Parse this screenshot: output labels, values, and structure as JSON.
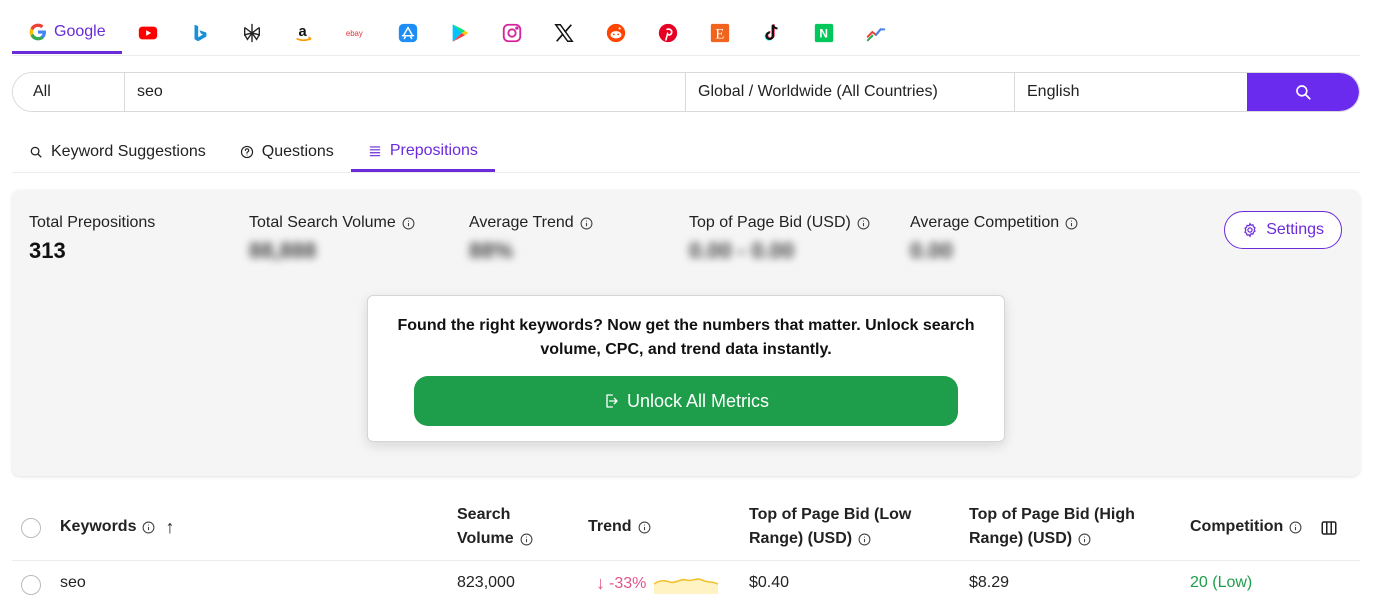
{
  "engines": {
    "google_label": "Google",
    "icons": [
      "youtube-icon",
      "bing-icon",
      "perplexity-icon",
      "amazon-icon",
      "ebay-icon",
      "app-store-icon",
      "google-play-icon",
      "instagram-icon",
      "x-icon",
      "reddit-icon",
      "pinterest-icon",
      "etsy-icon",
      "tiktok-icon",
      "naver-icon",
      "trends-icon"
    ],
    "ebay_text": "ebay",
    "amazon_text": "a",
    "etsy_text": "E",
    "naver_text": "N"
  },
  "search": {
    "type": "All",
    "query": "seo",
    "country": "Global / Worldwide (All Countries)",
    "language": "English"
  },
  "subtabs": {
    "suggestions": "Keyword Suggestions",
    "questions": "Questions",
    "prepositions": "Prepositions"
  },
  "stats": {
    "total_label": "Total Prepositions",
    "total_value": "313",
    "volume_label": "Total Search Volume",
    "volume_value": "88,888",
    "trend_label": "Average Trend",
    "trend_value": "88%",
    "bid_label": "Top of Page Bid (USD)",
    "bid_value": "0.00 - 0.00",
    "competition_label": "Average Competition",
    "competition_value": "0.00",
    "settings_label": "Settings"
  },
  "unlock": {
    "message": "Found the right keywords? Now get the numbers that matter. Unlock search volume, CPC, and trend data instantly.",
    "button": "Unlock All Metrics"
  },
  "table": {
    "headers": {
      "keywords": "Keywords",
      "sort_arrow": "↑",
      "volume_line1": "Search",
      "volume_line2": "Volume",
      "trend": "Trend",
      "bid_low_line1": "Top of Page Bid (Low",
      "bid_low_line2": "Range) (USD)",
      "bid_high_line1": "Top of Page Bid (High",
      "bid_high_line2": "Range) (USD)",
      "competition": "Competition"
    },
    "rows": [
      {
        "keyword": "seo",
        "volume": "823,000",
        "trend_arrow": "↓",
        "trend": "-33%",
        "bid_low": "$0.40",
        "bid_high": "$8.29",
        "competition": "20 (Low)"
      }
    ]
  },
  "colors": {
    "accent": "#6b2bd9",
    "search_button": "#6b2bef",
    "unlock_button": "#1e9e4a",
    "trend_negative": "#e0558a",
    "competition_low": "#1e9e4a"
  }
}
